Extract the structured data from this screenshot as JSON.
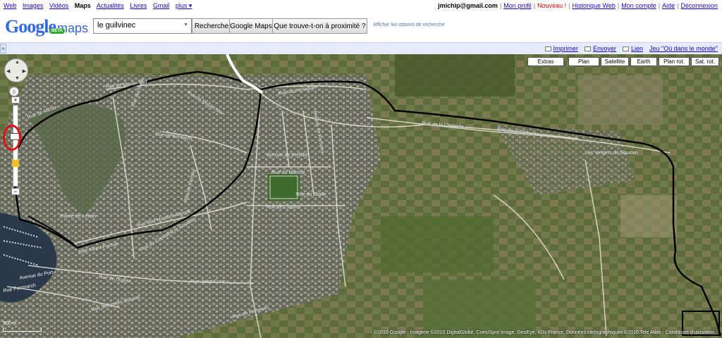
{
  "topnav": {
    "left": [
      "Web",
      "Images",
      "Vidéos",
      "Maps",
      "Actualités",
      "Livres",
      "Gmail",
      "plus ▾"
    ],
    "right": {
      "email": "jmichip@gmail.com",
      "profile": "Mon profil",
      "new": "Nouveau !",
      "history": "Historique Web",
      "account": "Mon compte",
      "help": "Aide",
      "logout": "Déconnexion"
    }
  },
  "header": {
    "logo_text": "Google",
    "logo_maps": "maps",
    "logo_badge": "BETA",
    "search_value": "le guilvinec",
    "btn_search": "Recherche",
    "btn_maps": "Google Maps",
    "btn_nearby": "Que trouve-t-on à proximité ?",
    "options_link": "Afficher les options de recherche"
  },
  "linkbar": {
    "print": "Imprimer",
    "send": "Envoyer",
    "link": "Lien",
    "world": "Jeu \"Où dans le monde\""
  },
  "map": {
    "types": [
      "Extras",
      "Plan",
      "Satellite",
      "Earth",
      "Plan rot.",
      "Sat. rot."
    ],
    "scale": "500 m",
    "copyright": "©2010 Google - Imagerie ©2010 DigitalGlobe, Cnes/Spot Image, GeoEye, IGN-France, Données cartographiques ©2010 Tele Atlas - Conditions d'utilisation",
    "streets": [
      "Rue de Moulin-Mer",
      "Rue de Moulin-Mer",
      "Rue de Kerlaguen",
      "Rue de Mérez",
      "Rue de Kervarch",
      "Rue du Stade",
      "Rue de la Chapelle",
      "Rue de la Chapelle",
      "Rue du Marché",
      "Avenue de Kerbilis",
      "Rue des Sports",
      "Rue du Stade",
      "Rue du Président Allende",
      "Rue de Kerbilis",
      "Rue du Capitaine le Gouallec",
      "Rue Albert Pachat",
      "Rue de l'Église",
      "Rue Joliot Curie",
      "Rue Sébastien Durand",
      "Rue de Kernévez",
      "Avenue du Port",
      "Rue Penmarch",
      "Avenue de Kerozen"
    ],
    "places": [
      "Les Vergers de Squidan",
      "Pointe de Léhan"
    ]
  }
}
